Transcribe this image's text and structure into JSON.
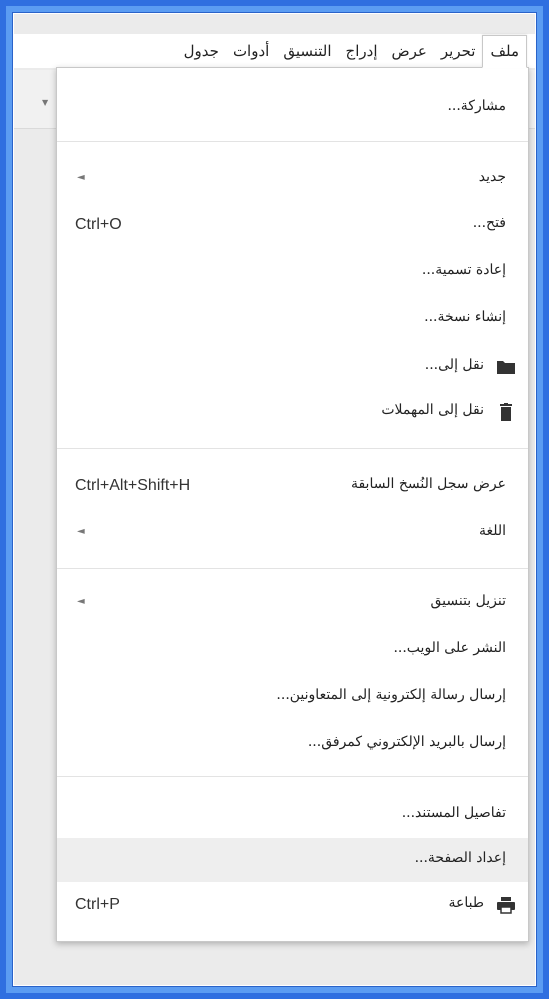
{
  "menubar": {
    "items": [
      {
        "label": "ملف",
        "active": true
      },
      {
        "label": "تحرير",
        "active": false
      },
      {
        "label": "عرض",
        "active": false
      },
      {
        "label": "إدراج",
        "active": false
      },
      {
        "label": "التنسيق",
        "active": false
      },
      {
        "label": "أدوات",
        "active": false
      },
      {
        "label": "جدول",
        "active": false
      }
    ]
  },
  "file_menu": {
    "share": {
      "label": "مشاركة..."
    },
    "new": {
      "label": "جديد"
    },
    "open": {
      "label": "فتح...",
      "shortcut": "Ctrl+O"
    },
    "rename": {
      "label": "إعادة تسمية..."
    },
    "make_copy": {
      "label": "إنشاء نسخة..."
    },
    "move_to": {
      "label": "نقل إلى...",
      "icon": "folder-icon"
    },
    "move_to_trash": {
      "label": "نقل إلى المهملات",
      "icon": "trash-icon"
    },
    "revision_history": {
      "label": "عرض سجل النُسخ السابقة",
      "shortcut": "Ctrl+Alt+Shift+H"
    },
    "language": {
      "label": "اللغة"
    },
    "download_as": {
      "label": "تنزيل بتنسيق"
    },
    "publish": {
      "label": "النشر على الويب..."
    },
    "email_collaborators": {
      "label": "إرسال رسالة إلكترونية إلى المتعاونين..."
    },
    "email_attachment": {
      "label": "إرسال بالبريد الإلكتروني كمرفق..."
    },
    "document_details": {
      "label": "تفاصيل المستند..."
    },
    "page_setup": {
      "label": "إعداد الصفحة...",
      "highlighted": true
    },
    "print": {
      "label": "طباعة",
      "shortcut": "Ctrl+P",
      "icon": "printer-icon"
    }
  },
  "colors": {
    "frame_blue": "#2f6fe0",
    "highlight": "#eeeeee",
    "icon": "#333333"
  }
}
